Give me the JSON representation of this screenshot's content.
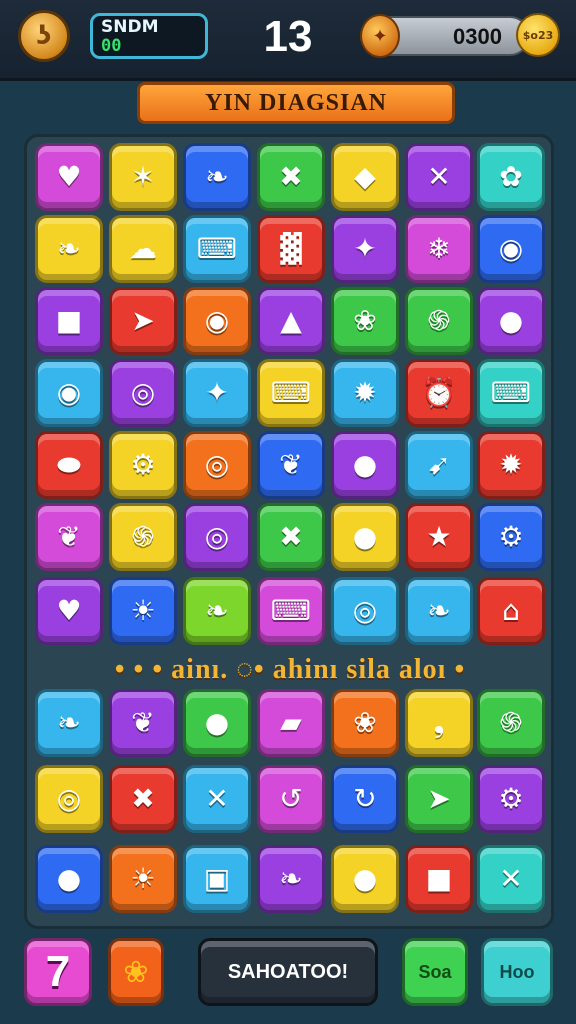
{
  "header": {
    "left_icon": "spiral-coin-icon",
    "left_icon_glyph": "ʖ",
    "score_label": "SNDM",
    "score_value": "00",
    "moves": "13",
    "coin_icon": "coin-icon",
    "coin_icon_glyph": "✦",
    "coin_value": "0300",
    "coin_badge": "$o23"
  },
  "banner": {
    "title": "YIN DIAGSIAN"
  },
  "combo_text": "•  •  • ainı. ◌• ahinı sila  aloı •",
  "colors": {
    "magenta": "#d34bd8",
    "yellow": "#f4d326",
    "blue": "#2f6bf2",
    "green": "#3ec84a",
    "teal": "#33d1c6",
    "red": "#e83a2e",
    "orange": "#f3701c",
    "purple": "#9a40e0",
    "cyan": "#36b6ec",
    "lime": "#7cd62b"
  },
  "rows_top": [
    [
      {
        "color": "magenta",
        "icon": "heart-icon",
        "glyph": "♥"
      },
      {
        "color": "yellow",
        "icon": "bone-icon",
        "glyph": "✶"
      },
      {
        "color": "blue",
        "icon": "leaf-icon",
        "glyph": "❧"
      },
      {
        "color": "green",
        "icon": "cross-swords-icon",
        "glyph": "✖"
      },
      {
        "color": "yellow",
        "icon": "gem-icon",
        "glyph": "◆"
      },
      {
        "color": "purple",
        "icon": "x-mark-icon",
        "glyph": "✕"
      },
      {
        "color": "teal",
        "icon": "bug-icon",
        "glyph": "✿"
      }
    ],
    [
      {
        "color": "yellow",
        "icon": "leaf-icon",
        "glyph": "❧"
      },
      {
        "color": "yellow",
        "icon": "blob-icon",
        "glyph": "☁"
      },
      {
        "color": "cyan",
        "icon": "gamepad-icon",
        "glyph": "⌨"
      },
      {
        "color": "red",
        "icon": "keyboard-icon",
        "glyph": "▓"
      },
      {
        "color": "purple",
        "icon": "wand-icon",
        "glyph": "✦"
      },
      {
        "color": "magenta",
        "icon": "popsicle-icon",
        "glyph": "❄"
      },
      {
        "color": "blue",
        "icon": "camera-icon",
        "glyph": "◉"
      }
    ],
    [
      {
        "color": "purple",
        "icon": "cube-icon",
        "glyph": "■"
      },
      {
        "color": "red",
        "icon": "paper-plane-icon",
        "glyph": "➤"
      },
      {
        "color": "orange",
        "icon": "seed-icon",
        "glyph": "◉"
      },
      {
        "color": "purple",
        "icon": "kite-icon",
        "glyph": "▲"
      },
      {
        "color": "green",
        "icon": "ring-icon",
        "glyph": "❀"
      },
      {
        "color": "green",
        "icon": "swirl-icon",
        "glyph": "֍"
      },
      {
        "color": "purple",
        "icon": "drop-icon",
        "glyph": "●"
      }
    ],
    [
      {
        "color": "cyan",
        "icon": "camera-icon",
        "glyph": "◉"
      },
      {
        "color": "purple",
        "icon": "ring-icon",
        "glyph": "◎"
      },
      {
        "color": "cyan",
        "icon": "wand-icon",
        "glyph": "✦"
      },
      {
        "color": "yellow",
        "icon": "gamepad-icon",
        "glyph": "⌨"
      },
      {
        "color": "cyan",
        "icon": "torch-icon",
        "glyph": "✹"
      },
      {
        "color": "red",
        "icon": "alarm-icon",
        "glyph": "⏰"
      },
      {
        "color": "teal",
        "icon": "gamepad-icon",
        "glyph": "⌨"
      }
    ],
    [
      {
        "color": "red",
        "icon": "ladybug-icon",
        "glyph": "⬬"
      },
      {
        "color": "yellow",
        "icon": "gear-icon",
        "glyph": "⚙"
      },
      {
        "color": "orange",
        "icon": "ring-icon",
        "glyph": "◎"
      },
      {
        "color": "blue",
        "icon": "bird-icon",
        "glyph": "❦"
      },
      {
        "color": "purple",
        "icon": "orange-ball-icon",
        "glyph": "●"
      },
      {
        "color": "cyan",
        "icon": "arrow-icon",
        "glyph": "➹"
      },
      {
        "color": "red",
        "icon": "star-badge-icon",
        "glyph": "✹"
      }
    ],
    [
      {
        "color": "magenta",
        "icon": "sprout-icon",
        "glyph": "❦"
      },
      {
        "color": "yellow",
        "icon": "swirl-icon",
        "glyph": "֍"
      },
      {
        "color": "purple",
        "icon": "ring-icon",
        "glyph": "◎"
      },
      {
        "color": "green",
        "icon": "x-mark-icon",
        "glyph": "✖"
      },
      {
        "color": "yellow",
        "icon": "orange-ball-icon",
        "glyph": "●"
      },
      {
        "color": "red",
        "icon": "star-icon",
        "glyph": "★"
      },
      {
        "color": "blue",
        "icon": "gear-icon",
        "glyph": "⚙"
      }
    ],
    [
      {
        "color": "purple",
        "icon": "balloon-icon",
        "glyph": "♥"
      },
      {
        "color": "blue",
        "icon": "sun-icon",
        "glyph": "☀"
      },
      {
        "color": "lime",
        "icon": "leaf-icon",
        "glyph": "❧"
      },
      {
        "color": "magenta",
        "icon": "gamepad-icon",
        "glyph": "⌨"
      },
      {
        "color": "cyan",
        "icon": "ring-icon",
        "glyph": "◎"
      },
      {
        "color": "cyan",
        "icon": "leaf-icon",
        "glyph": "❧"
      },
      {
        "color": "red",
        "icon": "house-icon",
        "glyph": "⌂"
      }
    ]
  ],
  "rows_bottom": [
    [
      {
        "color": "cyan",
        "icon": "leaf-icon",
        "glyph": "❧"
      },
      {
        "color": "purple",
        "icon": "sprout-icon",
        "glyph": "❦"
      },
      {
        "color": "green",
        "icon": "orange-ball-icon",
        "glyph": "●"
      },
      {
        "color": "magenta",
        "icon": "box-icon",
        "glyph": "▰"
      },
      {
        "color": "orange",
        "icon": "pig-icon",
        "glyph": "❀"
      },
      {
        "color": "yellow",
        "icon": "comma-icon",
        "glyph": "❟"
      },
      {
        "color": "green",
        "icon": "spiral-icon",
        "glyph": "֍"
      }
    ],
    [
      {
        "color": "yellow",
        "icon": "ring-icon",
        "glyph": "◎"
      },
      {
        "color": "red",
        "icon": "x-mark-icon",
        "glyph": "✖"
      },
      {
        "color": "cyan",
        "icon": "x-mark-icon",
        "glyph": "✕"
      },
      {
        "color": "magenta",
        "icon": "arrow-curve-icon",
        "glyph": "↺"
      },
      {
        "color": "blue",
        "icon": "arrow-curve-icon",
        "glyph": "↻"
      },
      {
        "color": "green",
        "icon": "bird-icon",
        "glyph": "➤"
      },
      {
        "color": "purple",
        "icon": "gear-icon",
        "glyph": "⚙"
      }
    ],
    [
      {
        "color": "blue",
        "icon": "lemon-icon",
        "glyph": "●"
      },
      {
        "color": "orange",
        "icon": "sun-icon",
        "glyph": "☀"
      },
      {
        "color": "cyan",
        "icon": "robot-icon",
        "glyph": "▣"
      },
      {
        "color": "purple",
        "icon": "leaf-icon",
        "glyph": "❧"
      },
      {
        "color": "yellow",
        "icon": "orange-ball-icon",
        "glyph": "●"
      },
      {
        "color": "red",
        "icon": "box-icon",
        "glyph": "■"
      },
      {
        "color": "teal",
        "icon": "sword-icon",
        "glyph": "✕"
      }
    ]
  ],
  "footer": {
    "seven_label": "7",
    "blob_icon": "blob-icon",
    "blob_glyph": "❀",
    "action_label": "SAHOATOO!",
    "green_label": "Soa",
    "cyan_label": "Hoo"
  }
}
